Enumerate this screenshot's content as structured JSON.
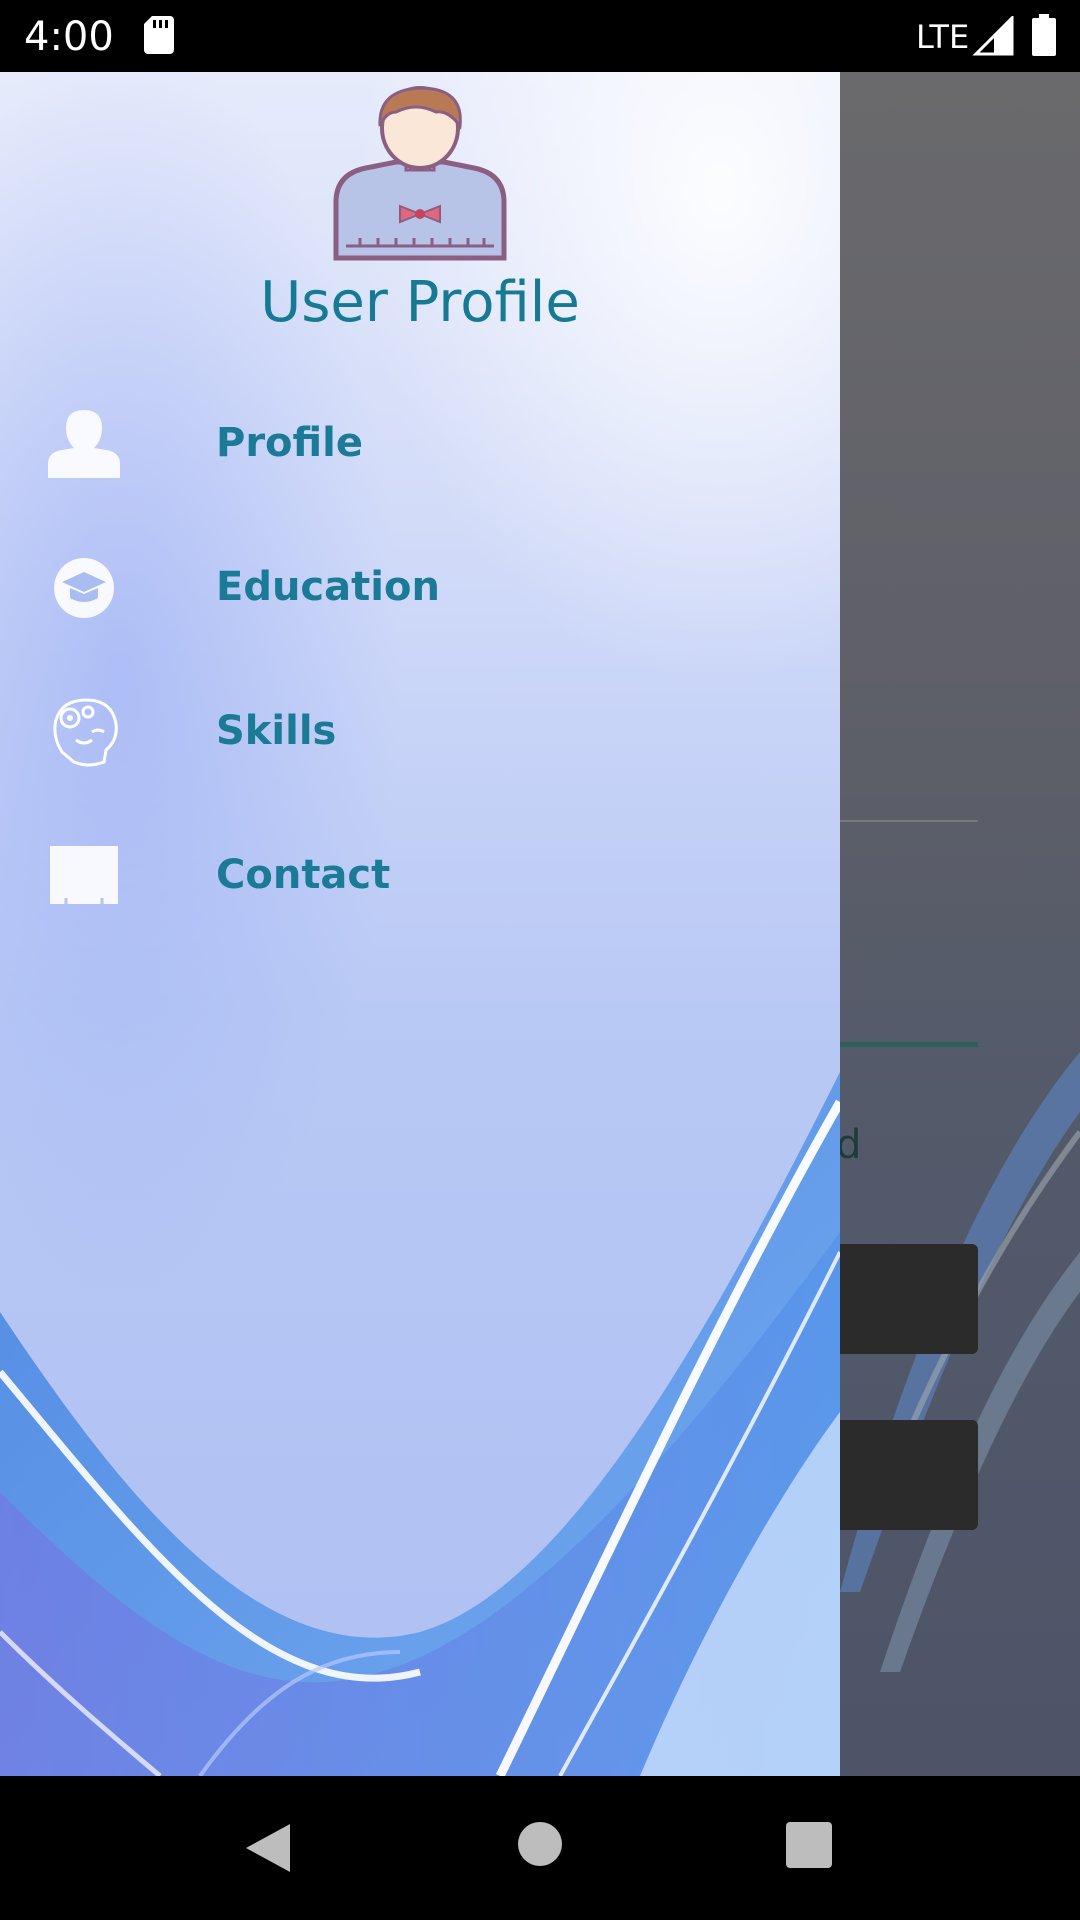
{
  "status_bar": {
    "time": "4:00",
    "network": "LTE",
    "icons": [
      "sd-card-icon",
      "signal-icon",
      "battery-icon"
    ]
  },
  "drawer": {
    "header_icon": "user-avatar-icon",
    "title": "User Profile",
    "items": [
      {
        "label": "Profile",
        "icon": "person-icon"
      },
      {
        "label": "Education",
        "icon": "graduation-cap-icon"
      },
      {
        "label": "Skills",
        "icon": "brain-gears-icon"
      },
      {
        "label": "Contact",
        "icon": "contact-card-icon"
      }
    ]
  },
  "background_app": {
    "partial_text": "d"
  },
  "nav_bar": {
    "icons": [
      "back-icon",
      "home-icon",
      "recents-icon"
    ]
  },
  "colors": {
    "accent_text": "#1b7a96",
    "title_text": "#177a94",
    "drawer_bg": "#c9d5f7",
    "scrim": "#5c5f68"
  }
}
